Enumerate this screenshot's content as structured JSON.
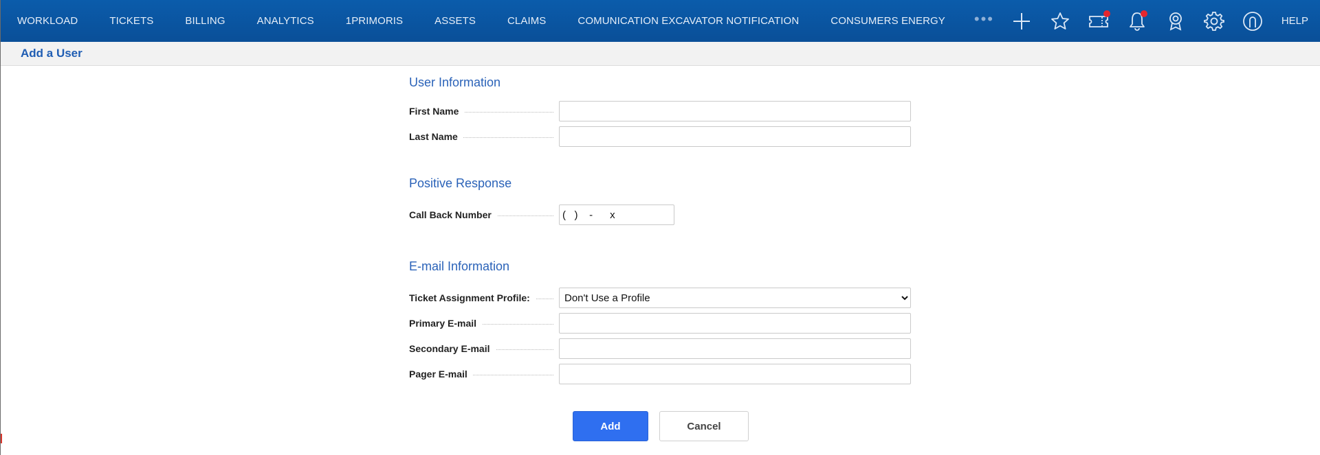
{
  "nav": {
    "items": [
      {
        "label": "WORKLOAD"
      },
      {
        "label": "TICKETS"
      },
      {
        "label": "BILLING"
      },
      {
        "label": "ANALYTICS"
      },
      {
        "label": "1PRIMORIS"
      },
      {
        "label": "ASSETS"
      },
      {
        "label": "CLAIMS"
      },
      {
        "label": "COMUNICATION EXCAVATOR NOTIFICATION"
      },
      {
        "label": "CONSUMERS ENERGY"
      }
    ],
    "more": "•••",
    "help": "HELP",
    "tool_icons": [
      "plus-icon",
      "star-icon",
      "ticket-icon",
      "bell-icon",
      "award-icon",
      "gear-icon",
      "user-icon"
    ],
    "notification_color": "#e5262e"
  },
  "page": {
    "title": "Add a User"
  },
  "user_info": {
    "title": "User Information",
    "first_name_label": "First Name",
    "first_name_value": "",
    "last_name_label": "Last Name",
    "last_name_value": ""
  },
  "positive_response": {
    "title": "Positive Response",
    "call_back_label": "Call Back Number",
    "call_back_value": "(   )    -      x"
  },
  "email_info": {
    "title": "E-mail Information",
    "profile_label": "Ticket Assignment Profile:",
    "profile_selected": "Don't Use a Profile",
    "primary_label": "Primary E-mail",
    "primary_value": "",
    "secondary_label": "Secondary E-mail",
    "secondary_value": "",
    "pager_label": "Pager E-mail",
    "pager_value": ""
  },
  "actions": {
    "add_label": "Add",
    "cancel_label": "Cancel"
  },
  "colors": {
    "nav_bg": "#0b5cab",
    "accent": "#2a62b8",
    "primary_button": "#2f6ff0"
  }
}
